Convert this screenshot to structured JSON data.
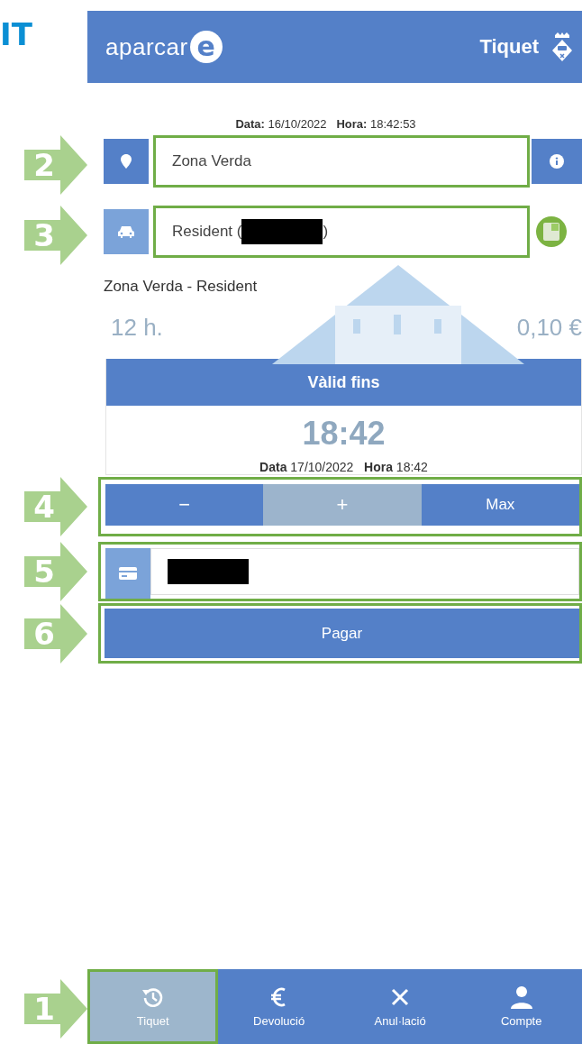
{
  "heading_fragment": "IT",
  "header": {
    "logo_text": "aparcar",
    "logo_mark": "e",
    "title": "Tiquet"
  },
  "timestamp": {
    "date_label": "Data:",
    "date": "16/10/2022",
    "time_label": "Hora:",
    "time": "18:42:53"
  },
  "zone": {
    "callout": "2",
    "value": "Zona Verda"
  },
  "vehicle": {
    "callout": "3",
    "prefix": "Resident (",
    "suffix": ")"
  },
  "tariff": {
    "title": "Zona Verda - Resident",
    "duration": "12 h.",
    "price": "0,10 €"
  },
  "validity": {
    "heading": "Vàlid fins",
    "time": "18:42",
    "date_label": "Data",
    "date": "17/10/2022",
    "time_label": "Hora",
    "hour": "18:42"
  },
  "stepper": {
    "callout": "4",
    "buttons": [
      {
        "label": "−",
        "disabled": false
      },
      {
        "label": "+",
        "disabled": true
      },
      {
        "label": "Max",
        "disabled": false
      }
    ]
  },
  "payment": {
    "callout": "5"
  },
  "pay_button": {
    "callout": "6",
    "label": "Pagar"
  },
  "nav": {
    "callout": "1",
    "items": [
      {
        "label": "Tiquet",
        "selected": true
      },
      {
        "label": "Devolució",
        "selected": false
      },
      {
        "label": "Anul·lació",
        "selected": false
      },
      {
        "label": "Compte",
        "selected": false
      }
    ]
  }
}
